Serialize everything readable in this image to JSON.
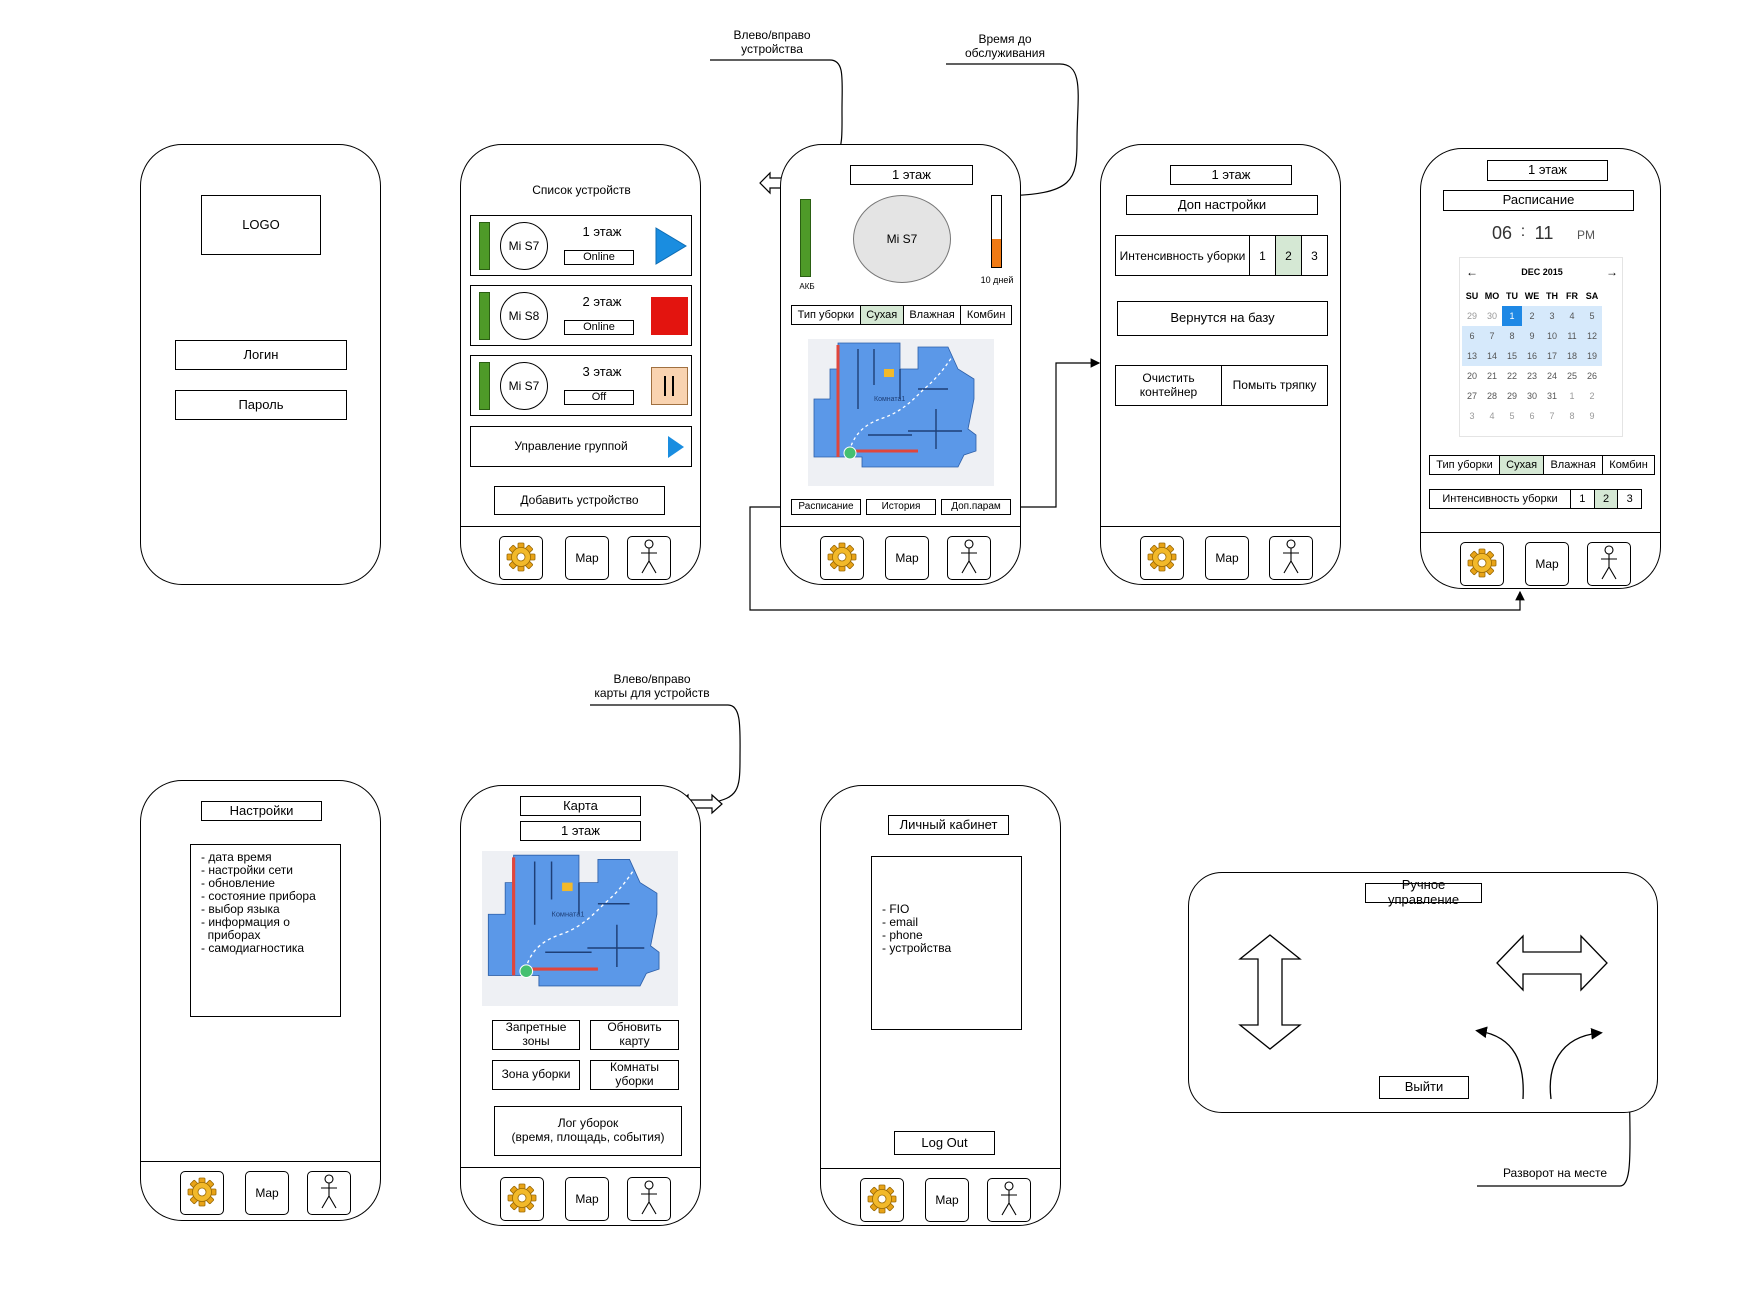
{
  "annotations": {
    "swipe_devices": "Влево/вправо\nустройства",
    "service_time": "Время до\nобслуживания",
    "swipe_maps": "Влево/вправо\nкарты для устройств",
    "turn_in_place": "Разворот на месте"
  },
  "nav": {
    "map_label": "Map",
    "settings_icon": "gear-icon",
    "profile_icon": "person-icon"
  },
  "login": {
    "logo": "LOGO",
    "login_field": "Логин",
    "password_field": "Пароль"
  },
  "devices": {
    "title": "Список устройств",
    "items": [
      {
        "name": "Mi S7",
        "floor": "1 этаж",
        "status": "Online",
        "action_icon": "play-icon"
      },
      {
        "name": "Mi S8",
        "floor": "2 этаж",
        "status": "Online",
        "action_icon": "stop-icon"
      },
      {
        "name": "Mi S7",
        "floor": "3 этаж",
        "status": "Off",
        "action_icon": "pause-icon"
      }
    ],
    "group_control": "Управление группой",
    "add_device": "Добавить устройство"
  },
  "control": {
    "floor": "1 этаж",
    "device": "Mi S7",
    "battery_label": "АКБ",
    "service_label": "10 дней",
    "cleaning_type": {
      "label": "Тип уборки",
      "options": [
        "Сухая",
        "Влажная",
        "Комбин"
      ],
      "selected": "Сухая"
    },
    "bottom_buttons": [
      "Расписание",
      "История",
      "Доп.парам"
    ],
    "map_room_label": "Комната1"
  },
  "extra": {
    "floor": "1 этаж",
    "title": "Доп настройки",
    "intensity": {
      "label": "Интенсивность уборки",
      "options": [
        "1",
        "2",
        "3"
      ],
      "selected": "2"
    },
    "return_base": "Вернутся на базу",
    "clean_container": "Очистить контейнер",
    "wash_mop": "Помыть тряпку"
  },
  "schedule": {
    "floor": "1 этаж",
    "title": "Расписание",
    "time": {
      "hours": "06",
      "sep": ":",
      "minutes": "11",
      "ampm": "PM"
    },
    "calendar": {
      "month": "DEC 2015",
      "prev_icon": "arrow-left-icon",
      "next_icon": "arrow-right-icon",
      "weekdays": [
        "SU",
        "MO",
        "TU",
        "WE",
        "TH",
        "FR",
        "SA"
      ],
      "weeks": [
        [
          "29",
          "30",
          "1",
          "2",
          "3",
          "4",
          "5"
        ],
        [
          "6",
          "7",
          "8",
          "9",
          "10",
          "11",
          "12"
        ],
        [
          "13",
          "14",
          "15",
          "16",
          "17",
          "18",
          "19"
        ],
        [
          "20",
          "21",
          "22",
          "23",
          "24",
          "25",
          "26"
        ],
        [
          "27",
          "28",
          "29",
          "30",
          "31",
          "1",
          "2"
        ],
        [
          "3",
          "4",
          "5",
          "6",
          "7",
          "8",
          "9"
        ]
      ],
      "selected_day": "1"
    },
    "cleaning_type": {
      "label": "Тип уборки",
      "options": [
        "Сухая",
        "Влажная",
        "Комбин"
      ],
      "selected": "Сухая"
    },
    "intensity": {
      "label": "Интенсивность уборки",
      "options": [
        "1",
        "2",
        "3"
      ],
      "selected": "2"
    }
  },
  "settings": {
    "title": "Настройки",
    "items": [
      "- дата время",
      "- настройки сети",
      "- обновление",
      "- состояние прибора",
      "- выбор языка",
      "- информация о\n  приборах",
      "- самодиагностика"
    ]
  },
  "mapscreen": {
    "title": "Карта",
    "floor": "1 этаж",
    "buttons": [
      "Запретные\nзоны",
      "Обновить\nкарту",
      "Зона уборки",
      "Комнаты\nуборки"
    ],
    "log": "Лог уборок\n(время, площадь, события)"
  },
  "profile": {
    "title": "Личный кабинет",
    "items": [
      "- FIO",
      "- email",
      "- phone",
      "- устройства"
    ],
    "logout": "Log Out"
  },
  "manual": {
    "title": "Ручное управление",
    "exit": "Выйти"
  },
  "colors": {
    "green_bar": "#4e9a28",
    "play_blue": "#1a8de0",
    "stop_red": "#e3140f",
    "pause_bg": "#f9d3b0",
    "service_orange": "#f07a14",
    "map_blue": "#5b98e8",
    "selection_green": "#d5e8d4"
  }
}
